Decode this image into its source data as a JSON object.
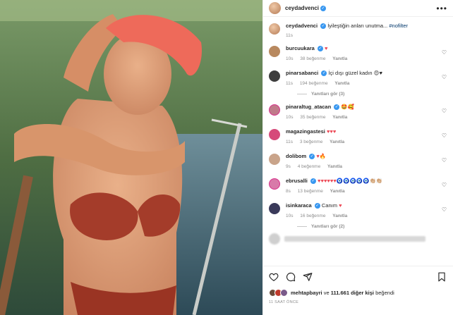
{
  "post": {
    "author": "ceydadvenci",
    "caption_text": "İyileştiğin anları unutma... ",
    "caption_hashtag": "#nofilter",
    "caption_time": "11s"
  },
  "header": {
    "more_label": "•••"
  },
  "comments": [
    {
      "user": "burcuukara",
      "text": "",
      "emoji": "♥",
      "time": "10s",
      "likes": "38 beğenme",
      "reply": "Yanıtla",
      "verified": true,
      "avatar_color": "#b8895f"
    },
    {
      "user": "pinarsabanci",
      "text": "İçi dışı güzel kadın ",
      "emoji": "😍♥",
      "time": "11s",
      "likes": "194 beğenme",
      "reply": "Yanıtla",
      "verified": true,
      "avatar_color": "#3d3d3d"
    },
    {
      "user": "pinaraltug_atacan",
      "text": "",
      "emoji": "🤩🥰",
      "time": "10s",
      "likes": "35 beğenme",
      "reply": "Yanıtla",
      "verified": true,
      "avatar_color": "#c07a8a"
    },
    {
      "user": "magazingastesi",
      "text": "",
      "emoji": "♥♥♥",
      "time": "11s",
      "likes": "3 beğenme",
      "reply": "Yanıtla",
      "verified": false,
      "avatar_color": "#d64a7a"
    },
    {
      "user": "dolibom",
      "text": "",
      "emoji": "♥🔥",
      "time": "9s",
      "likes": "4 beğenme",
      "reply": "Yanıtla",
      "verified": true,
      "avatar_color": "#c9a48a"
    },
    {
      "user": "ebrusalli",
      "text": "",
      "emoji": "♥♥♥♥♥♥🧿🧿🧿🧿🧿👏🏼👏🏼",
      "time": "8s",
      "likes": "13 beğenme",
      "reply": "Yanıtla",
      "verified": true,
      "avatar_color": "#d87aa9"
    },
    {
      "user": "isinkaraca",
      "text": "Canım ",
      "emoji": "♥",
      "time": "10s",
      "likes": "16 beğenme",
      "reply": "Yanıtla",
      "verified": true,
      "avatar_color": "#3a3a5a"
    }
  ],
  "view_replies_3": "Yanıtları gör (3)",
  "view_replies_2": "Yanıtları gör (2)",
  "likes": {
    "first": "mehtapbayri",
    "connector": " ve ",
    "others": "111.661 diğer kişi",
    "suffix": " beğendi"
  },
  "timestamp": "11 SAAT ÖNCE",
  "icons": {
    "like": "heart-icon",
    "comment": "comment-icon",
    "share": "share-icon",
    "save": "bookmark-icon",
    "more": "more-icon"
  },
  "colors": {
    "verified": "#3897f0",
    "like_red": "#ed4956",
    "muted": "#8e8e8e",
    "hashtag": "#00376b"
  }
}
